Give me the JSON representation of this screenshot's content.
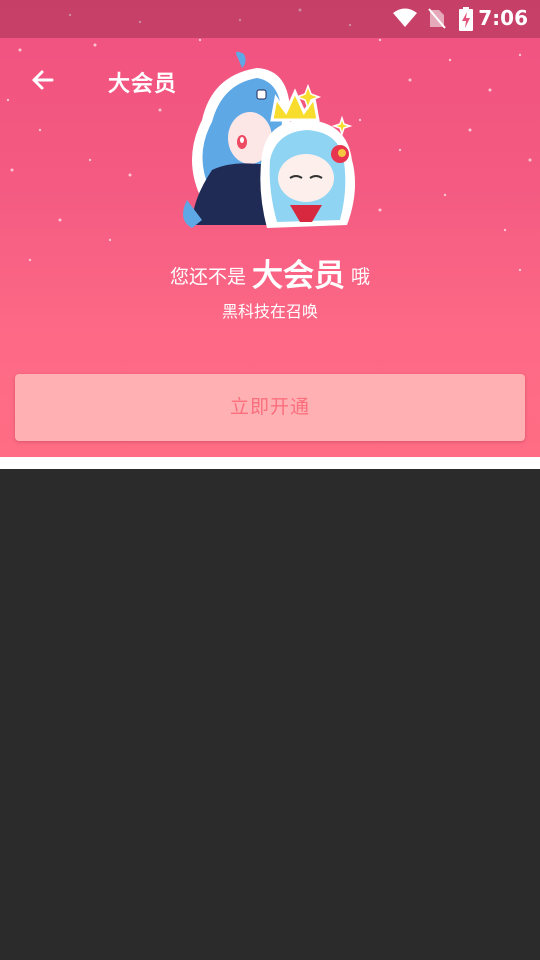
{
  "status_bar": {
    "time": "7:06",
    "icons": [
      "wifi-icon",
      "no-sim-icon",
      "battery-charging-icon"
    ]
  },
  "header": {
    "back_icon": "arrow-left-icon",
    "title": "大会员"
  },
  "hero": {
    "headline_prefix": "您还不是",
    "headline_emphasis": "大会员",
    "headline_suffix": "哦",
    "subtitle": "黑科技在召唤",
    "mascot": "mascot-characters-illustration"
  },
  "action": {
    "open_label": "立即开通"
  },
  "colors": {
    "hero_top": "#f0527f",
    "hero_bottom": "#fe6d84",
    "button_bg": "#ffb0b2",
    "button_text": "#fb6e7e",
    "content_bg": "#2b2b2b"
  }
}
